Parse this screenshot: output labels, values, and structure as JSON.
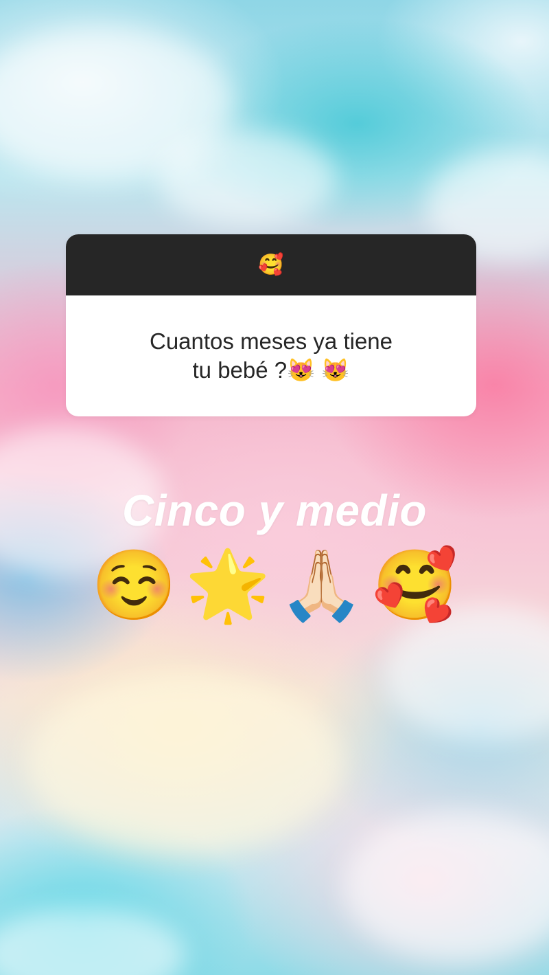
{
  "story": {
    "question_sticker": {
      "header_emoji": "🥰",
      "question_line1": "Cuantos meses ya tiene",
      "question_line2": "tu bebé ?😻 😻"
    },
    "answer": {
      "text": "Cinco y medio",
      "emojis": [
        "☺️",
        "🌟",
        "🙏🏻",
        "🥰"
      ]
    }
  },
  "colors": {
    "sticker_header": "#262626",
    "sticker_body": "#ffffff",
    "answer_text": "#ffffff"
  }
}
